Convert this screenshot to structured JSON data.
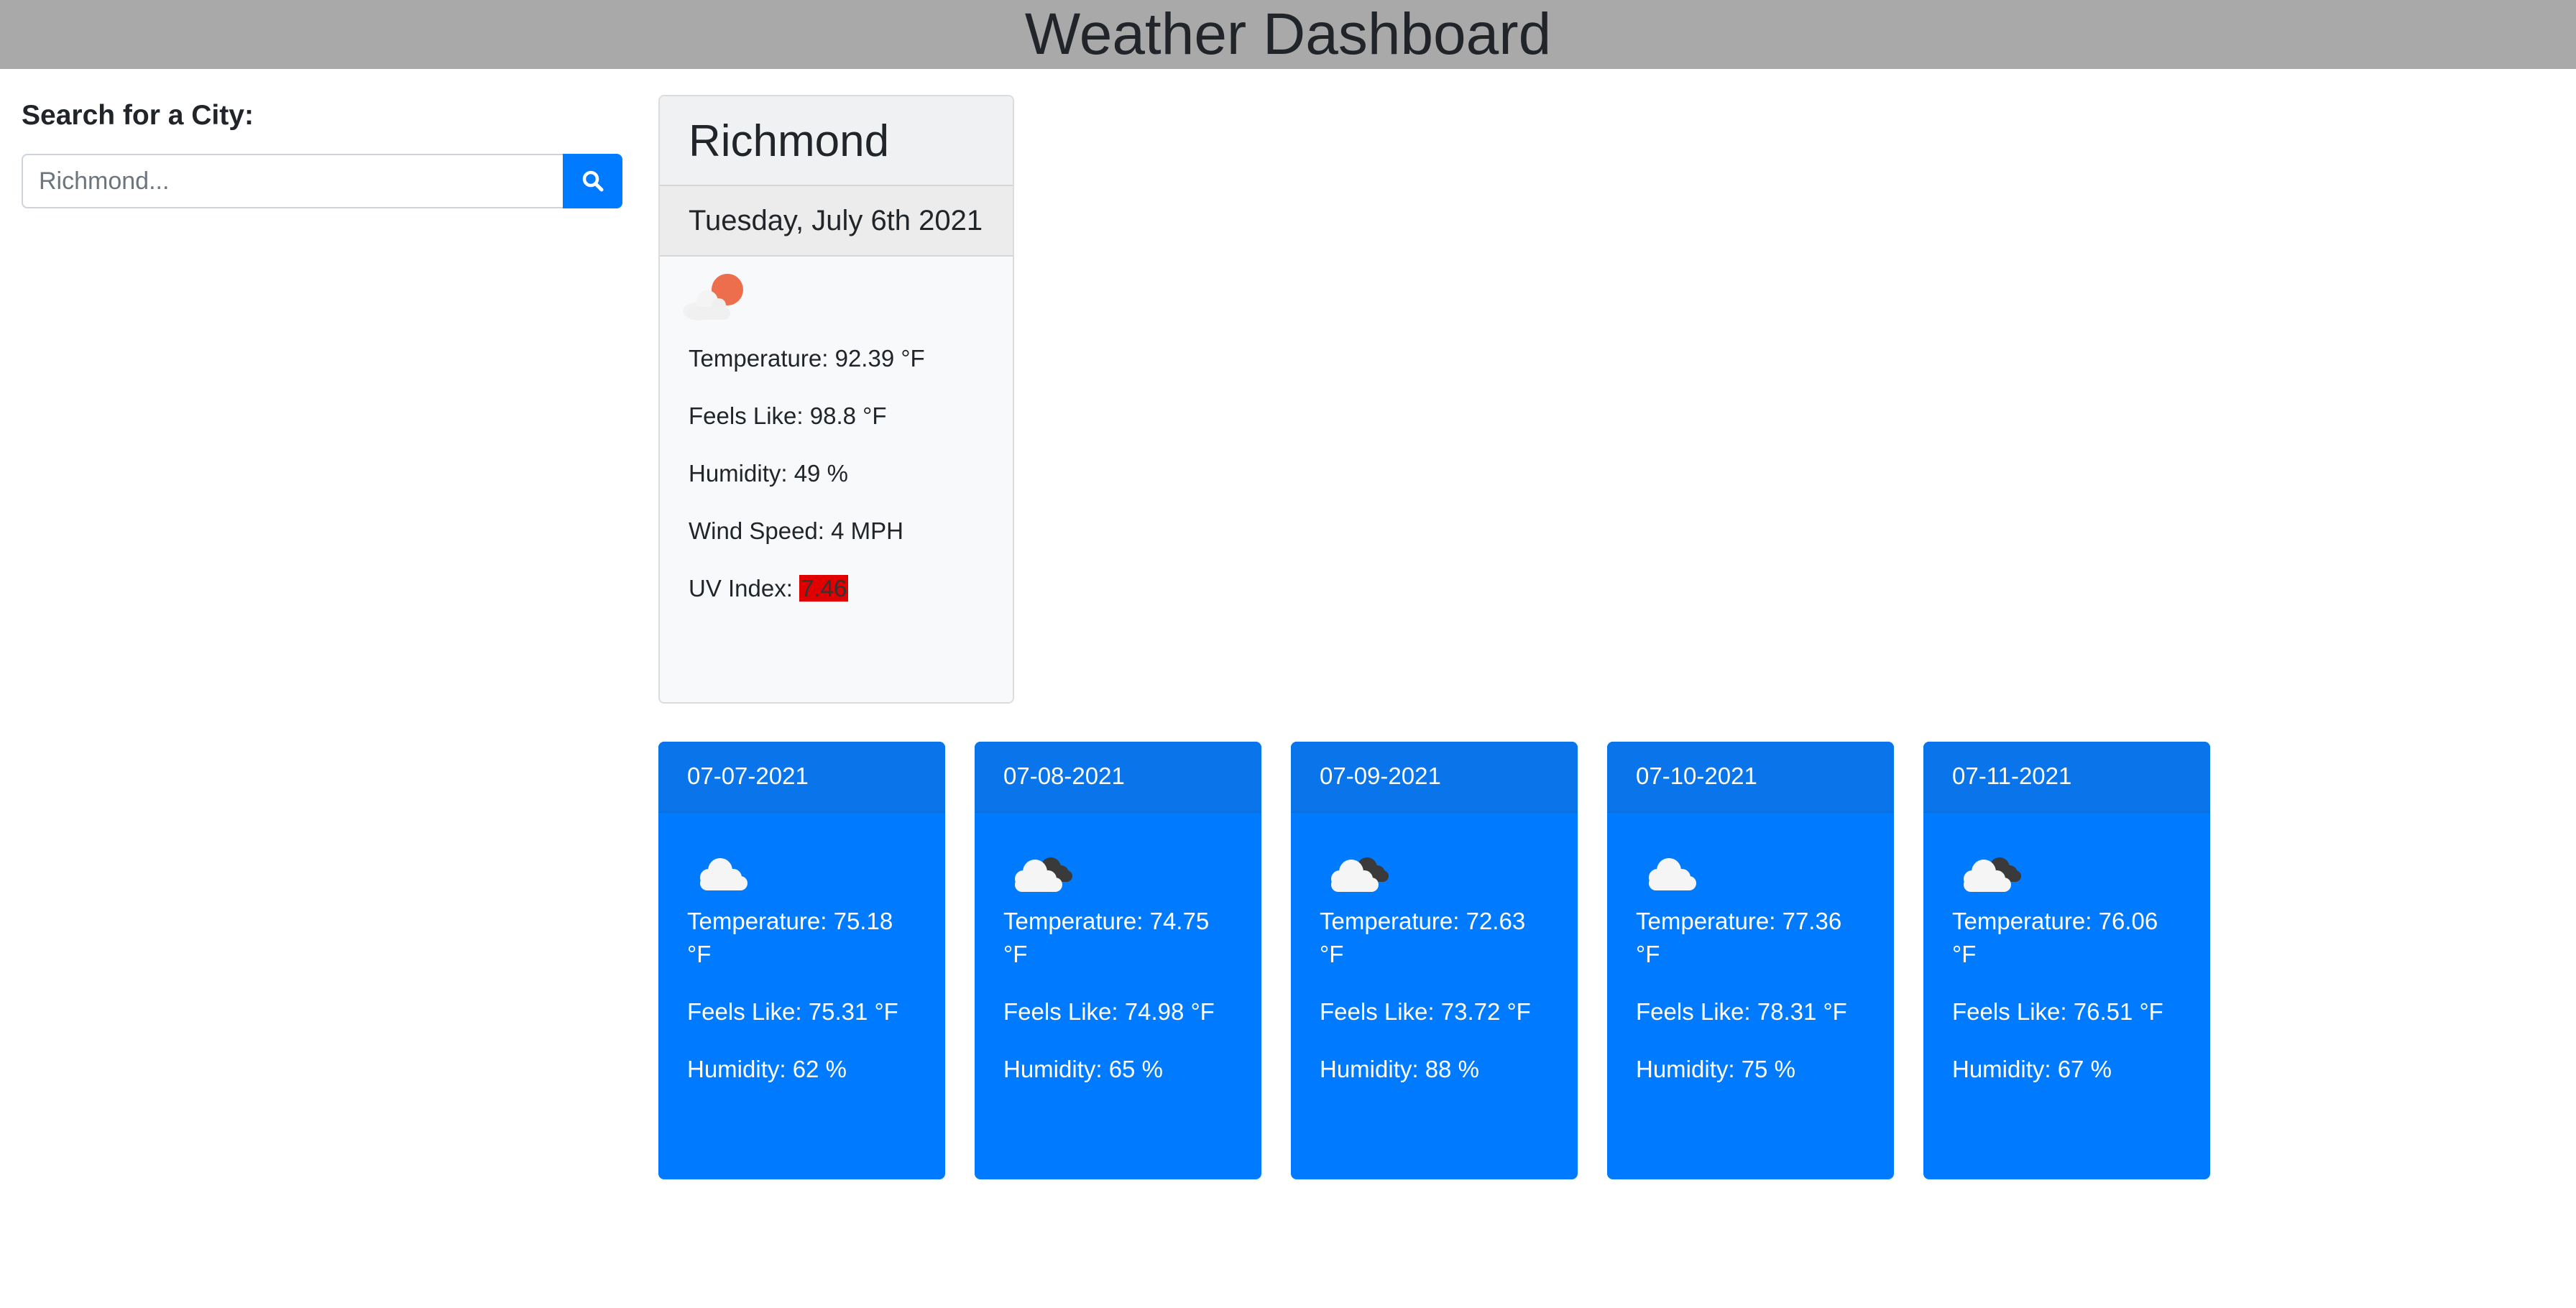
{
  "header": {
    "title": "Weather Dashboard"
  },
  "search": {
    "label": "Search for a City:",
    "placeholder": "Richmond...",
    "value": "",
    "button_icon": "search-icon"
  },
  "current": {
    "city": "Richmond",
    "date": "Tuesday, July 6th 2021",
    "icon": "few-clouds-day-icon",
    "temperature": "Temperature: 92.39 °F",
    "feels_like": "Feels Like: 98.8 °F",
    "humidity": "Humidity: 49 %",
    "wind_speed": "Wind Speed: 4 MPH",
    "uv_label": "UV Index: ",
    "uv_value": "7.46",
    "uv_color": "#e00000"
  },
  "forecast": [
    {
      "date": "07-07-2021",
      "icon": "cloud-icon",
      "temperature": "Temperature: 75.18 °F",
      "feels_like": "Feels Like: 75.31 °F",
      "humidity": "Humidity: 62 %"
    },
    {
      "date": "07-08-2021",
      "icon": "broken-clouds-icon",
      "temperature": "Temperature: 74.75 °F",
      "feels_like": "Feels Like: 74.98 °F",
      "humidity": "Humidity: 65 %"
    },
    {
      "date": "07-09-2021",
      "icon": "broken-clouds-icon",
      "temperature": "Temperature: 72.63 °F",
      "feels_like": "Feels Like: 73.72 °F",
      "humidity": "Humidity: 88 %"
    },
    {
      "date": "07-10-2021",
      "icon": "cloud-icon",
      "temperature": "Temperature: 77.36 °F",
      "feels_like": "Feels Like: 78.31 °F",
      "humidity": "Humidity: 75 %"
    },
    {
      "date": "07-11-2021",
      "icon": "broken-clouds-icon",
      "temperature": "Temperature: 76.06 °F",
      "feels_like": "Feels Like: 76.51 °F",
      "humidity": "Humidity: 67 %"
    }
  ],
  "colors": {
    "header_bg": "#a9a9a9",
    "accent": "#007bff",
    "card_bg": "#f8f9fa"
  }
}
